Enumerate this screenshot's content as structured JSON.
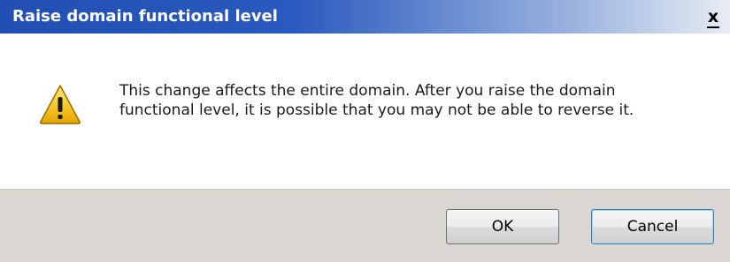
{
  "window": {
    "title": "Raise domain functional level",
    "close_label": "x"
  },
  "message": {
    "icon": "warning-icon",
    "text": "This change affects the entire domain. After you raise the domain functional level, it is possible that you may not be able to reverse it."
  },
  "buttons": {
    "ok_label": "OK",
    "cancel_label": "Cancel"
  },
  "colors": {
    "titlebar": "#2a59bf",
    "footer": "#dad6d2",
    "warning_fill": "#f5c400"
  }
}
